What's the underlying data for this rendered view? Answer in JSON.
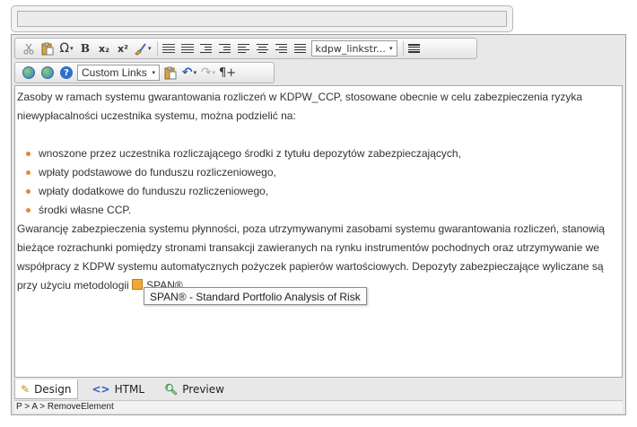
{
  "title_field": {
    "value": ""
  },
  "toolbar": {
    "row1": {
      "cut_icon": "scissors-icon",
      "paste_icon": "paste-icon",
      "symbol": "Ω",
      "bold": "B",
      "subscript": "x₂",
      "superscript": "x²",
      "format_dropdown": "kdpw_linkstr...",
      "caret": "▾"
    },
    "row2": {
      "links_dropdown": "Custom Links",
      "help": "?",
      "paragraph": "¶+",
      "undo": "↶",
      "redo": "↷",
      "caret": "▾"
    }
  },
  "content": {
    "p1": "Zasoby w ramach systemu gwarantowania rozliczeń w KDPW_CCP, stosowane obecnie w celu zabezpieczenia ryzyka niewypłacalności uczestnika systemu, można podzielić na:",
    "bullets": [
      "wnoszone przez uczestnika rozliczającego środki z tytułu depozytów zabezpieczających,",
      "wpłaty podstawowe do funduszu rozliczeniowego,",
      "wpłaty dodatkowe do funduszu rozliczeniowego,",
      "środki własne CCP."
    ],
    "p2": " Gwarancję zabezpieczenia systemu płynności, poza utrzymywanymi zasobami systemu gwarantowania rozliczeń, stanowią bieżące rozrachunki pomiędzy stronami transakcji zawieranych na rynku instrumentów pochodnych oraz utrzymywanie we współpracy z KDPW systemu automatycznych pożyczek papierów wartościowych. Depozyty zabezpieczające wyliczane są przy użyciu metodologii",
    "link_text": "SPAN®",
    "tooltip": "SPAN® - Standard Portfolio Analysis of Risk"
  },
  "modes": [
    {
      "label": "Design",
      "active": true
    },
    {
      "label": "HTML",
      "active": false
    },
    {
      "label": "Preview",
      "active": false
    }
  ],
  "status_bar": "P > A > RemoveElement",
  "colors": {
    "bullet": "#e08a2a",
    "accent": "#2f6fc9"
  }
}
